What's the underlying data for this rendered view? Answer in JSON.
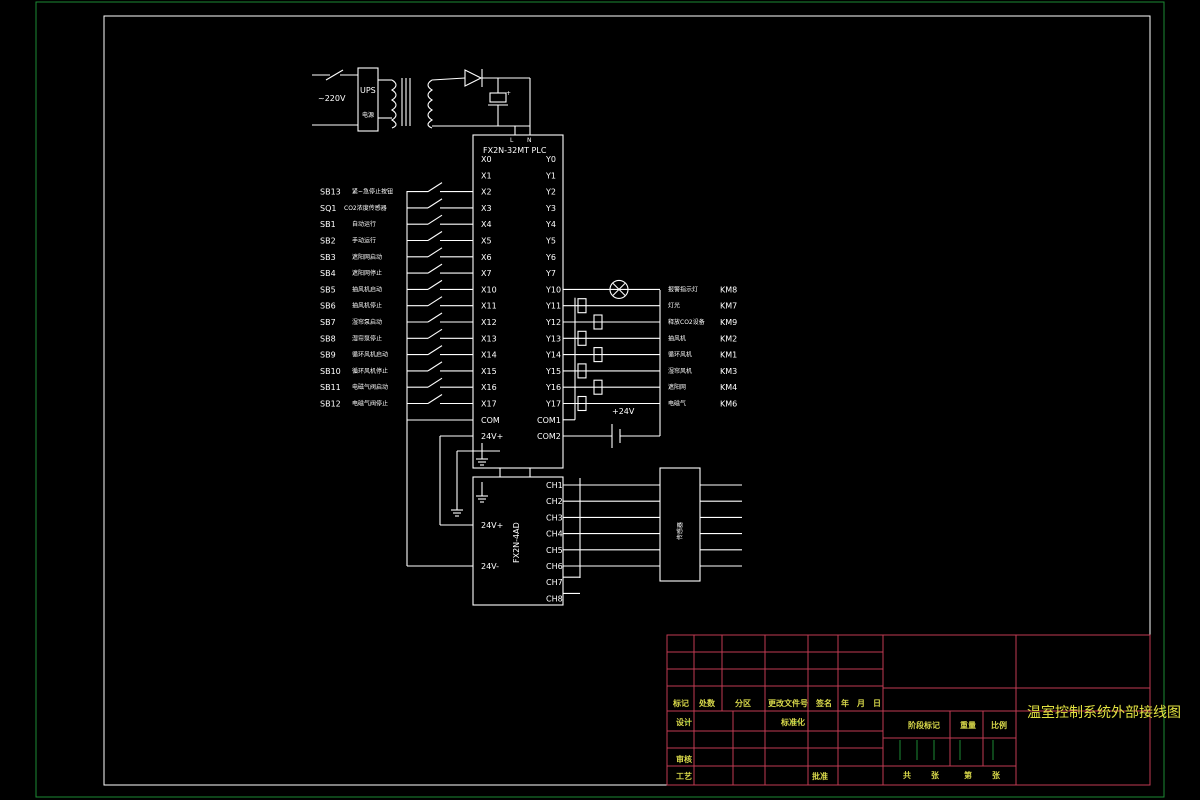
{
  "plc": {
    "model": "FX2N-32MT PLC",
    "L": "L",
    "N": "N",
    "x_pins": [
      "X0",
      "X1",
      "X2",
      "X3",
      "X4",
      "X5",
      "X6",
      "X7",
      "X10",
      "X11",
      "X12",
      "X13",
      "X14",
      "X15",
      "X16",
      "X17",
      "COM",
      "24V+"
    ],
    "y_pins": [
      "Y0",
      "Y1",
      "Y2",
      "Y3",
      "Y4",
      "Y5",
      "Y6",
      "Y7",
      "Y10",
      "Y11",
      "Y12",
      "Y13",
      "Y14",
      "Y15",
      "Y16",
      "Y17",
      "COM1",
      "COM2"
    ]
  },
  "power": {
    "voltage": "~220V",
    "ups": "UPS",
    "ups_sub": "电源"
  },
  "inputs": [
    {
      "code": "SB13",
      "desc": "紧~急停止按钮",
      "pin": "X2"
    },
    {
      "code": "SQ1",
      "desc": "CO2浓度传感器",
      "pin": "X3"
    },
    {
      "code": "SB1",
      "desc": "自动运行",
      "pin": "X4"
    },
    {
      "code": "SB2",
      "desc": "手动运行",
      "pin": "X5"
    },
    {
      "code": "SB3",
      "desc": "遮阳网启动",
      "pin": "X6"
    },
    {
      "code": "SB4",
      "desc": "遮阳网停止",
      "pin": "X7"
    },
    {
      "code": "SB5",
      "desc": "抽风机启动",
      "pin": "X10"
    },
    {
      "code": "SB6",
      "desc": "抽风机停止",
      "pin": "X11"
    },
    {
      "code": "SB7",
      "desc": "湿帘泵启动",
      "pin": "X12"
    },
    {
      "code": "SB8",
      "desc": "湿帘泵停止",
      "pin": "X13"
    },
    {
      "code": "SB9",
      "desc": "循环风机启动",
      "pin": "X14"
    },
    {
      "code": "SB10",
      "desc": "循环风机停止",
      "pin": "X15"
    },
    {
      "code": "SB11",
      "desc": "电磁气阀启动",
      "pin": "X16"
    },
    {
      "code": "SB12",
      "desc": "电磁气阀停止",
      "pin": "X17"
    }
  ],
  "outputs": [
    {
      "desc": "报警指示灯",
      "km": "KM8",
      "pin": "Y10"
    },
    {
      "desc": "灯光",
      "km": "KM7",
      "pin": "Y11"
    },
    {
      "desc": "释放CO2设备",
      "km": "KM9",
      "pin": "Y12"
    },
    {
      "desc": "抽风机",
      "km": "KM2",
      "pin": "Y13"
    },
    {
      "desc": "循环风机",
      "km": "KM1",
      "pin": "Y14"
    },
    {
      "desc": "湿帘风机",
      "km": "KM3",
      "pin": "Y15"
    },
    {
      "desc": "遮阳网",
      "km": "KM4",
      "pin": "Y16"
    },
    {
      "desc": "电磁气",
      "km": "KM6",
      "pin": "Y17"
    }
  ],
  "supply24": "+24V",
  "ad": {
    "model": "FX2N-4AD",
    "plus": "24V+",
    "minus": "24V-",
    "channels": [
      "CH1",
      "CH2",
      "CH3",
      "CH4",
      "CH5",
      "CH6",
      "CH7",
      "CH8"
    ]
  },
  "sensor_box": "传感器",
  "titleblock": {
    "title": "温室控制系统外部接线图",
    "row1": [
      "标记",
      "处数",
      "分区",
      "更改文件号",
      "签名",
      "年",
      "月",
      "日"
    ],
    "row2": [
      "设计",
      "标准化"
    ],
    "mid": [
      "阶段标记",
      "重量",
      "比例"
    ],
    "row3": [
      "审核"
    ],
    "row4": [
      "工艺",
      "批准"
    ],
    "sheets": [
      "共",
      "张",
      "第",
      "张"
    ]
  },
  "colors": {
    "frame": "#1d8a33",
    "titleblock": "#c03a52",
    "tb_text": "#d8d84a",
    "wiring": "#ffffff"
  }
}
